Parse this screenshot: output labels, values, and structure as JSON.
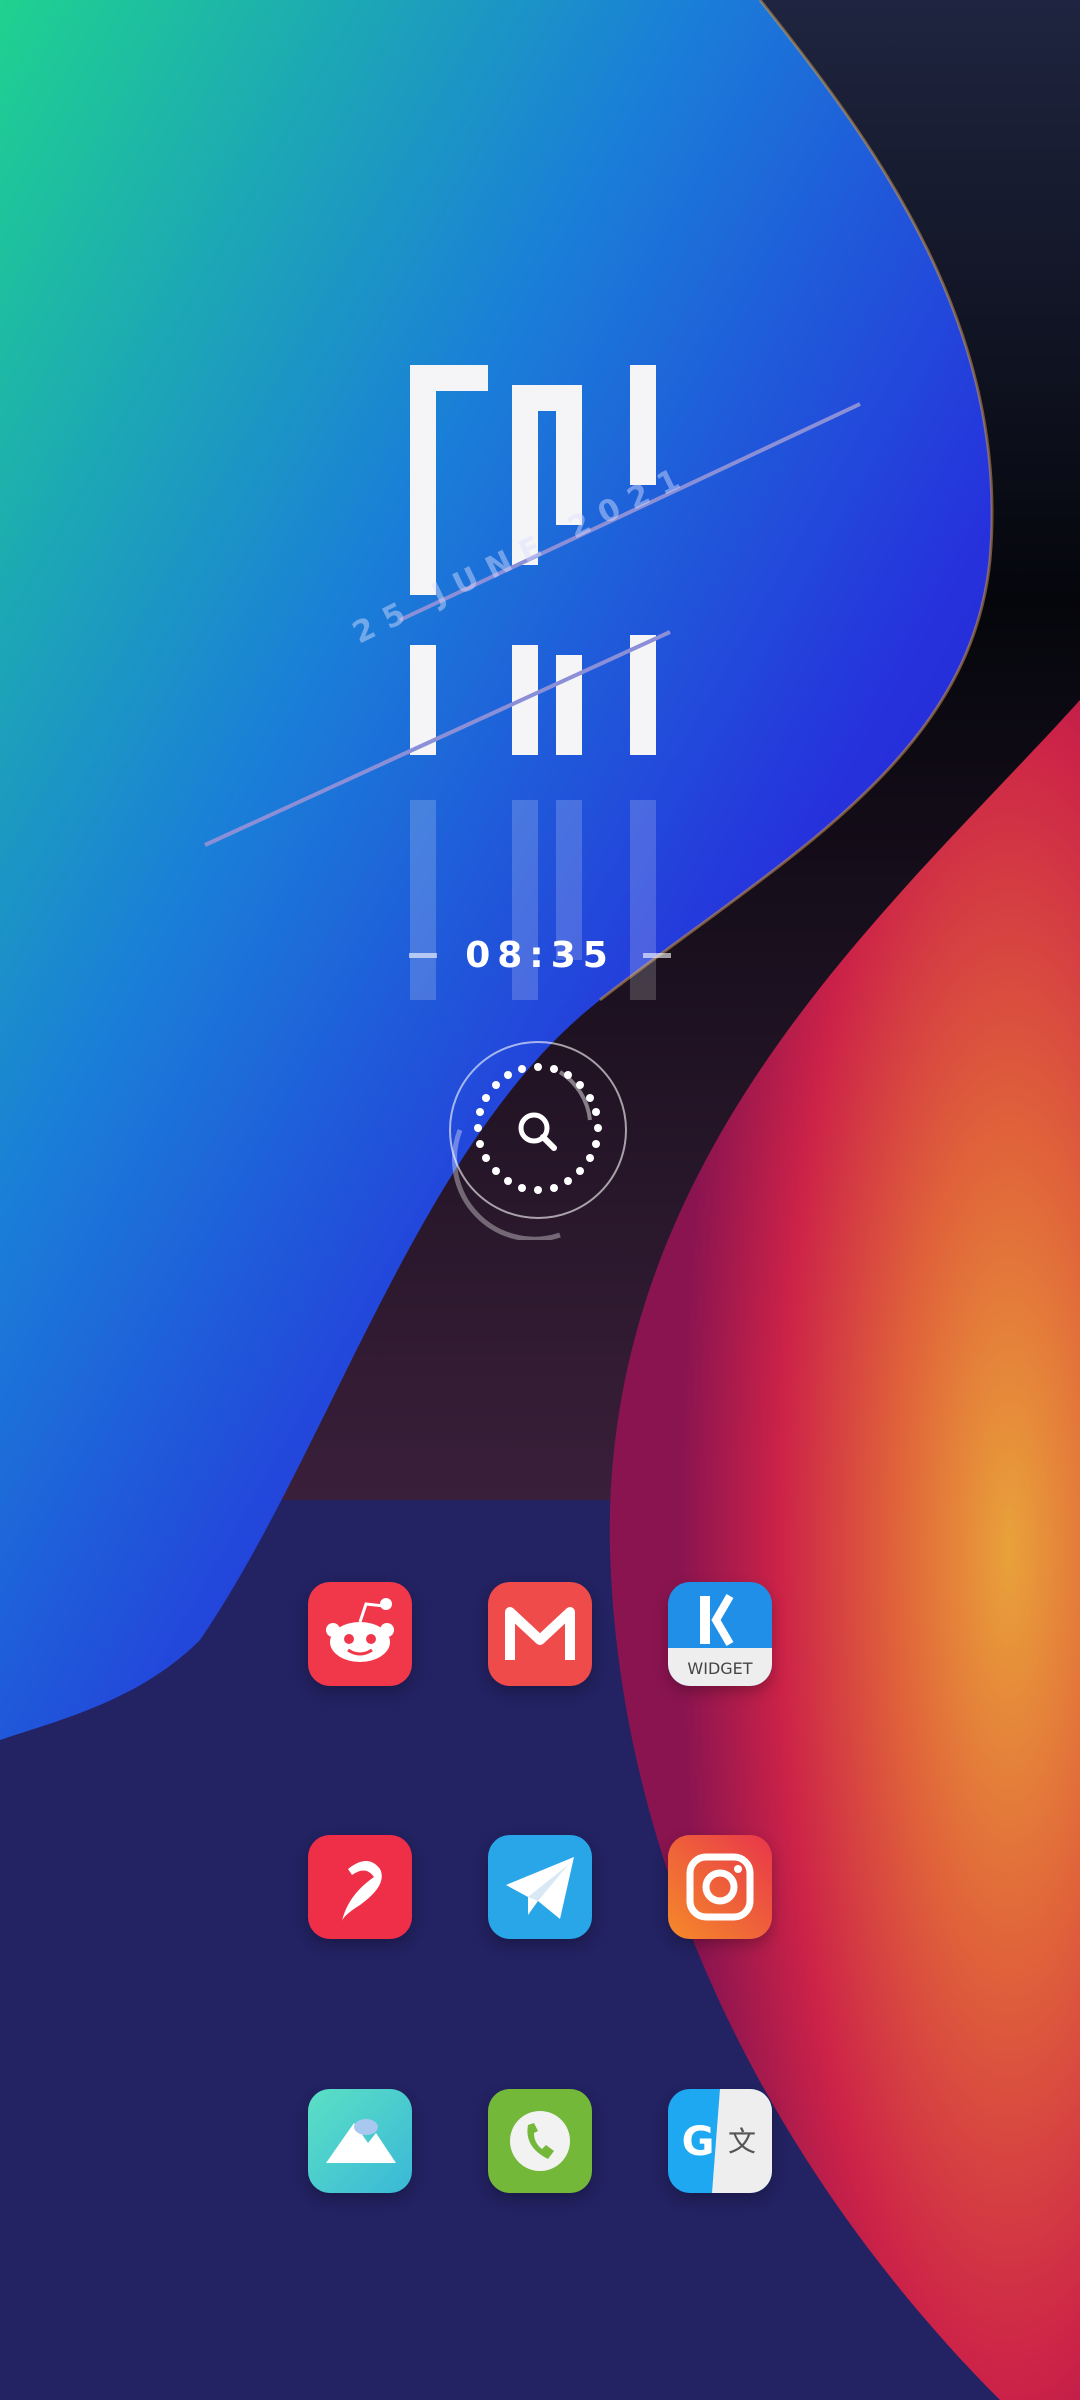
{
  "lockscreen": {
    "day_label": "FRI",
    "date_label": "25 JUNE 2021",
    "time": "08:35"
  },
  "search_widget": {
    "icon": "search-icon"
  },
  "apps": [
    {
      "name": "reddit",
      "icon": "reddit-icon",
      "color": "#f0384a"
    },
    {
      "name": "gmail",
      "icon": "gmail-icon",
      "color": "#ef4b4b"
    },
    {
      "name": "kwgt",
      "icon": "kwgt-icon",
      "label": "WIDGET",
      "color": "#1f8fe8"
    },
    {
      "name": "airtel",
      "icon": "airtel-icon",
      "color": "#ee2f47"
    },
    {
      "name": "telegram",
      "icon": "telegram-icon",
      "color": "#28a6e8"
    },
    {
      "name": "instagram",
      "icon": "instagram-icon",
      "color": "#f06a2f"
    },
    {
      "name": "gallery",
      "icon": "gallery-icon",
      "color": "#4ad7c0"
    },
    {
      "name": "phone",
      "icon": "phone-icon",
      "color": "#74b83a"
    },
    {
      "name": "google-translate",
      "icon": "translate-icon",
      "color": "#1ea8f2"
    }
  ],
  "colors": {
    "accent_blue": "#2b33dc",
    "accent_teal": "#1fd28f",
    "accent_orange": "#e8823a",
    "accent_red": "#d8284a",
    "background_navy": "#232262"
  }
}
